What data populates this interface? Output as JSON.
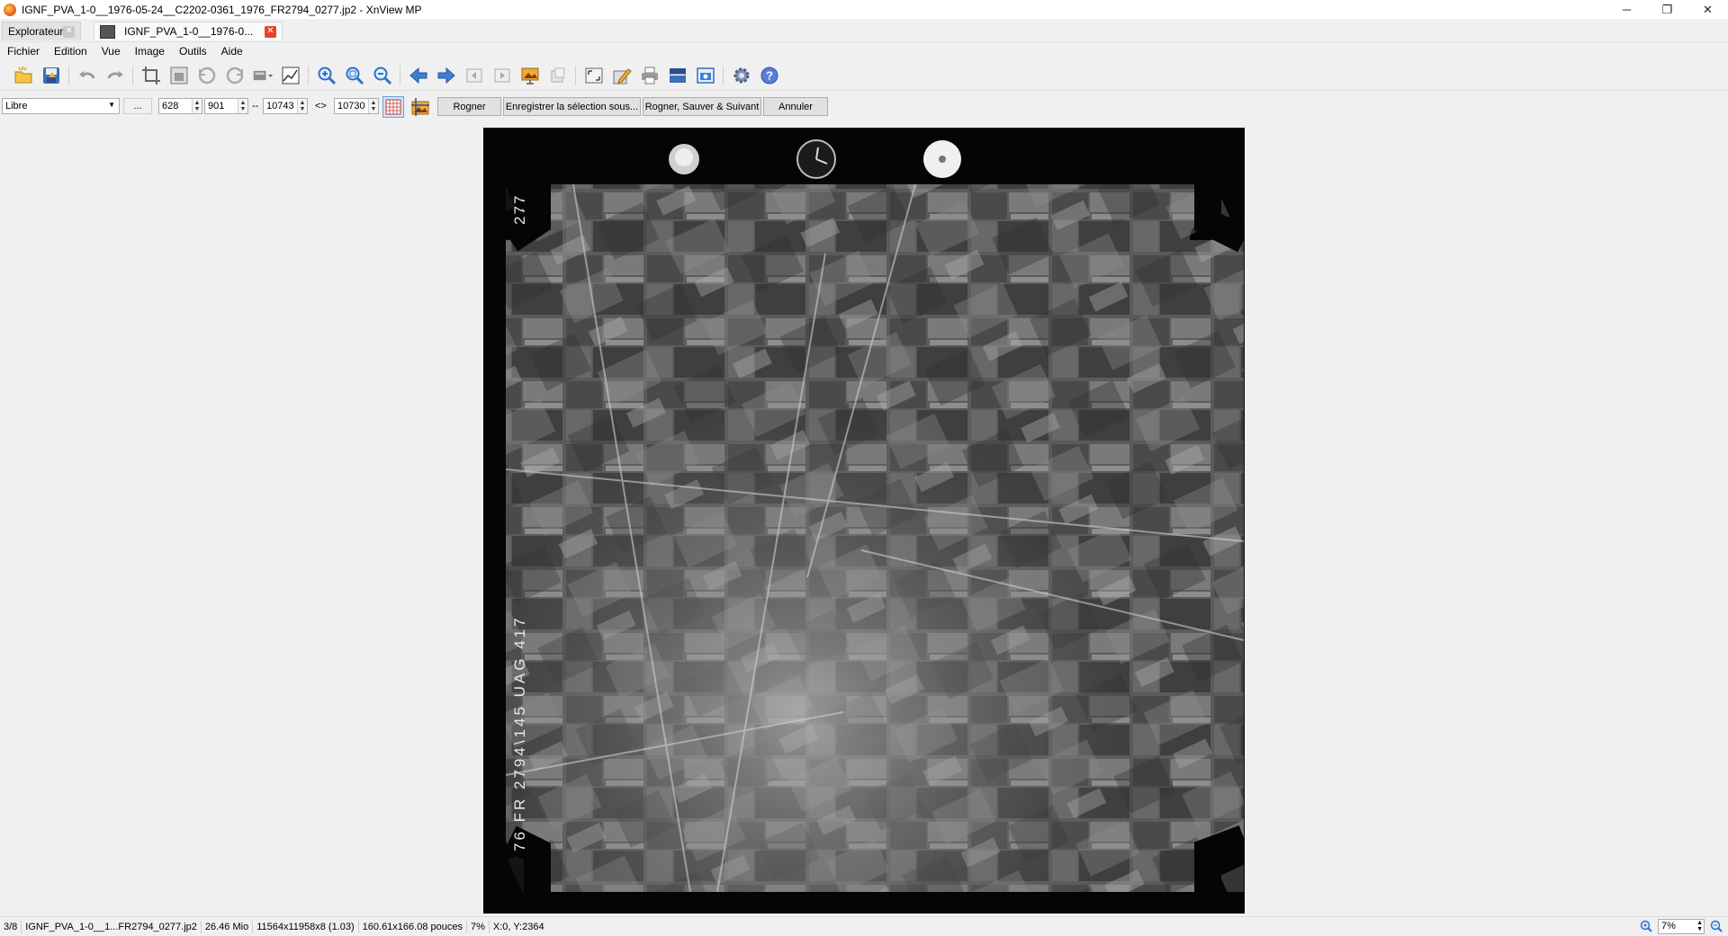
{
  "window": {
    "title": "IGNF_PVA_1-0__1976-05-24__C2202-0361_1976_FR2794_0277.jp2 - XnView MP",
    "minimize": "─",
    "restore": "❐",
    "close": "✕"
  },
  "tabs": [
    {
      "label": "Explorateur",
      "close": "✕"
    },
    {
      "label": "IGNF_PVA_1-0__1976-0...",
      "close": "✕"
    }
  ],
  "menu": [
    "Fichier",
    "Edition",
    "Vue",
    "Image",
    "Outils",
    "Aide"
  ],
  "toolbar": {
    "icons": [
      "browse-folder-icon",
      "save-icon",
      "undo-icon",
      "redo-icon",
      "crop-icon",
      "resize-icon",
      "rotate-left-icon",
      "rotate-right-icon",
      "adjust-icon",
      "histogram-icon",
      "zoom-in-icon",
      "zoom-fit-icon",
      "zoom-out-icon",
      "previous-icon",
      "next-icon",
      "first-icon",
      "last-icon",
      "slideshow-icon",
      "compare-icon",
      "fullscreen-icon",
      "edit-icon",
      "print-icon",
      "scanner-icon",
      "capture-icon",
      "settings-icon",
      "help-icon"
    ]
  },
  "cropbar": {
    "ratio_value": "Libre",
    "more_label": "...",
    "x_value": "628",
    "y_value": "901",
    "dash": "--",
    "w_value": "10743",
    "swap": "<>",
    "h_value": "10730",
    "crop_button": "Rogner",
    "save_selection_button": "Enregistrer la sélection sous...",
    "crop_save_next_button": "Rogner, Sauver & Suivant",
    "cancel_button": "Annuler"
  },
  "photo": {
    "frame_number": "277",
    "side_code": "76 FR 2794\\145 UAG 417"
  },
  "status": {
    "index": "3/8",
    "filename": "IGNF_PVA_1-0__1...FR2794_0277.jp2",
    "filesize": "26.46 Mio",
    "dimensions": "11564x11958x8 (1.03)",
    "print_size": "160.61x166.08 pouces",
    "zoom_pct": "7%",
    "coords": "X:0, Y:2364",
    "zoom_box": "7%"
  },
  "colors": {
    "tab_close_active": "#e8412c",
    "photo_border": "#050505"
  }
}
